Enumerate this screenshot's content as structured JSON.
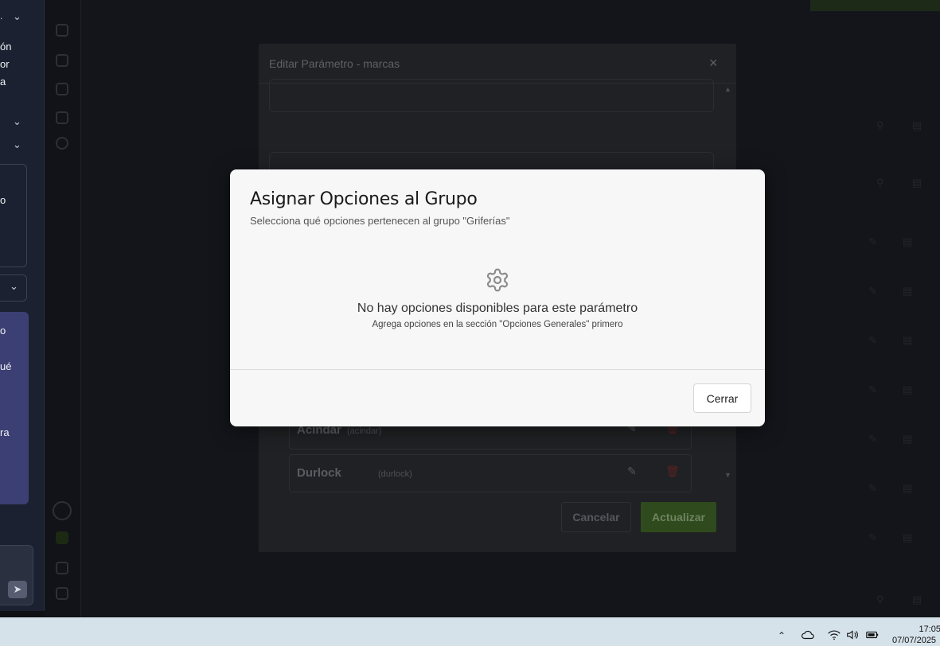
{
  "left_panel": {
    "text_lines": [
      "ón",
      "or",
      "a"
    ],
    "card_lines": [
      "o",
      "ué",
      "ra"
    ],
    "box_fragment": "o"
  },
  "edit_modal": {
    "title": "Editar Parámetro - marcas",
    "close_glyph": "×",
    "options": [
      {
        "name": "Acindar",
        "slug": "(acindar)"
      },
      {
        "name": "Durlock",
        "slug": "(durlock)"
      }
    ],
    "cancel_label": "Cancelar",
    "update_label": "Actualizar"
  },
  "assign_modal": {
    "title": "Asignar Opciones al Grupo",
    "subtitle": "Selecciona qué opciones pertenecen al grupo \"Griferías\"",
    "empty_icon": "gear-icon",
    "empty_title": "No hay opciones disponibles para este parámetro",
    "empty_subtitle": "Agrega opciones en la sección \"Opciones Generales\" primero",
    "close_label": "Cerrar"
  },
  "taskbar": {
    "time": "17:05",
    "date": "07/07/2025"
  },
  "colors": {
    "accent_green": "#5a8f2e",
    "danger_red": "#c62828"
  }
}
